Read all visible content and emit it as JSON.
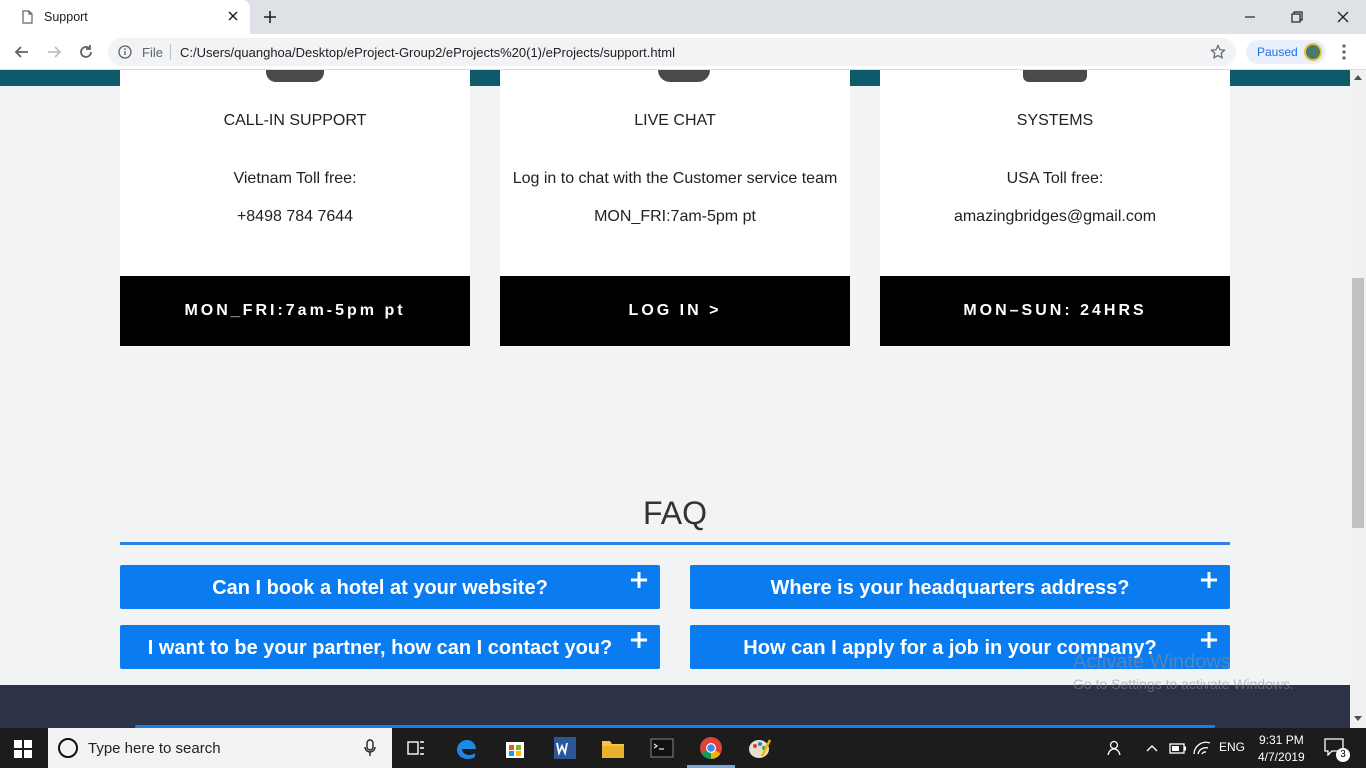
{
  "browser": {
    "tab_title": "Support",
    "url_scheme": "File",
    "url": "C:/Users/quanghoa/Desktop/eProject-Group2/eProjects%20(1)/eProjects/support.html",
    "profile_status": "Paused"
  },
  "cards": [
    {
      "title": "CALL-IN SUPPORT",
      "line1": "Vietnam Toll free:",
      "line2": "+8498 784 7644",
      "button": "MON_FRI:7am-5pm pt"
    },
    {
      "title": "LIVE CHAT",
      "line1": "Log in to chat with the Customer service team",
      "line2": "MON_FRI:7am-5pm pt",
      "button": "LOG IN >"
    },
    {
      "title": "SYSTEMS",
      "line1": "USA Toll free:",
      "line2": "amazingbridges@gmail.com",
      "button": "MON–SUN: 24HRS"
    }
  ],
  "faq": {
    "title": "FAQ",
    "items": [
      "Can I book a hotel at your website?",
      "Where is your headquarters address?",
      "I want to be your partner, how can I contact you?",
      "How can I apply for a job in your company?"
    ]
  },
  "watermark": {
    "line1": "Activate Windows",
    "line2": "Go to Settings to activate Windows."
  },
  "taskbar": {
    "search_placeholder": "Type here to search",
    "language": "ENG",
    "time": "9:31 PM",
    "date": "4/7/2019",
    "notification_count": "3"
  },
  "colors": {
    "faq_blue": "#0a7cf0",
    "button_black": "#000000",
    "footer": "#2c3247"
  }
}
